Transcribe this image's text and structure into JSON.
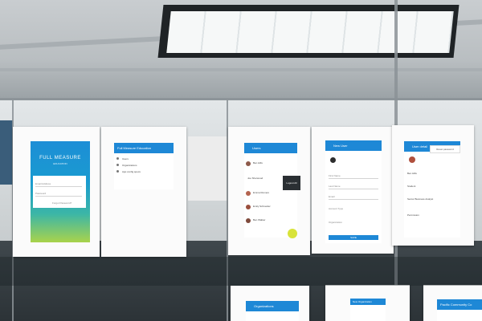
{
  "sheets": {
    "login": {
      "logo_title": "FULL MEASURE",
      "logo_subtitle": "EDUCATION",
      "field_1": "Email Address",
      "field_2": "Password",
      "link": "Forgot Password?"
    },
    "menu": {
      "appbar_title": "Full Measure Education",
      "items": [
        "Users",
        "Organizations",
        "App config specs"
      ]
    },
    "users": {
      "appbar_title": "Users",
      "rows": [
        "Ben Hills",
        "Joe Sherwood",
        "Emma Romero",
        "Emily Schneider",
        "Ben Walker"
      ],
      "popup": "Logout All"
    },
    "new_user": {
      "appbar_title": "New User",
      "fields": [
        "First Name",
        "Last Name",
        "Email",
        "Account Type",
        "Organization"
      ],
      "button": "SAVE"
    },
    "user_detail": {
      "appbar_title": "User detail",
      "menu_item": "Reset password",
      "values": [
        "Ben Hills",
        "Student",
        "Senior Business Analyst",
        "Permission"
      ]
    },
    "organizations": {
      "appbar_title": "Organizations"
    },
    "new_org": {
      "appbar_title": "New Organization"
    },
    "org_detail": {
      "appbar_title": "Pacific Community Co"
    }
  },
  "colors": {
    "app_blue": "#1e88d6",
    "fab_yellow": "#d8e33a"
  }
}
